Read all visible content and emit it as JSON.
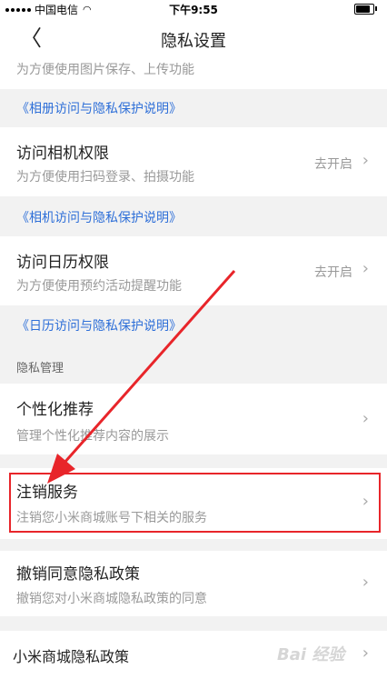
{
  "status": {
    "carrier": "中国电信",
    "time": "下午9:55"
  },
  "nav": {
    "title": "隐私设置",
    "back_icon": "chevron-left-icon"
  },
  "rows": {
    "photo": {
      "subtitle": "为方便使用图片保存、上传功能"
    },
    "photo_link": "《相册访问与隐私保护说明》",
    "camera": {
      "title": "访问相机权限",
      "subtitle": "为方便使用扫码登录、拍摄功能",
      "action": "去开启"
    },
    "camera_link": "《相机访问与隐私保护说明》",
    "calendar": {
      "title": "访问日历权限",
      "subtitle": "为方便使用预约活动提醒功能",
      "action": "去开启"
    },
    "calendar_link": "《日历访问与隐私保护说明》",
    "section_label": "隐私管理",
    "personalized": {
      "title": "个性化推荐",
      "subtitle": "管理个性化推荐内容的展示"
    },
    "cancel_service": {
      "title": "注销服务",
      "subtitle": "注销您小米商城账号下相关的服务"
    },
    "revoke": {
      "title": "撤销同意隐私政策",
      "subtitle": "撤销您对小米商城隐私政策的同意"
    },
    "policy": {
      "title": "小米商城隐私政策"
    }
  },
  "chevron": "›",
  "watermark": "Bai 经验",
  "colors": {
    "link": "#2e6fd8",
    "highlight": "#e8252a",
    "background": "#f2f2f2"
  }
}
